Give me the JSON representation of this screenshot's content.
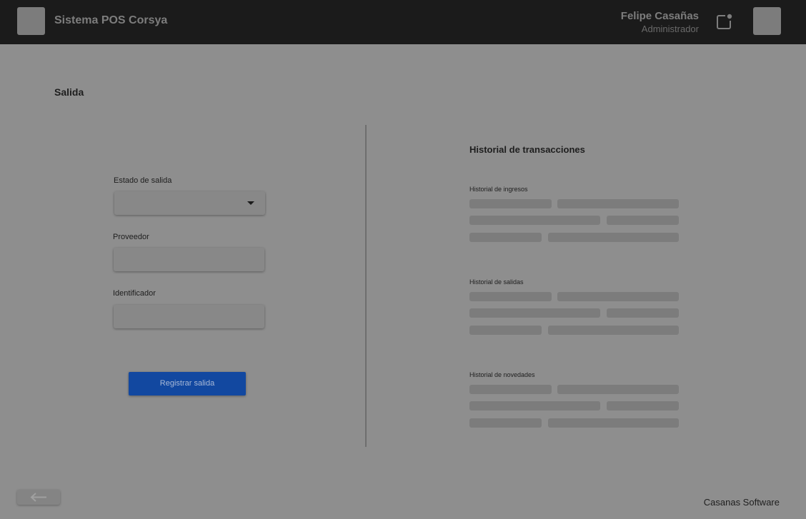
{
  "header": {
    "app_title": "Sistema POS Corsya",
    "user_name": "Felipe Casañas",
    "user_role": "Administrador",
    "logo_icon": "app-logo-placeholder",
    "notification_icon": "notification-icon",
    "avatar_icon": "avatar-placeholder"
  },
  "main": {
    "page_title": "Salida",
    "form": {
      "estado_label": "Estado de salida",
      "estado_value": "",
      "proveedor_label": "Proveedor",
      "proveedor_value": "",
      "identificador_label": "Identificador",
      "identificador_value": "",
      "submit_label": "Registrar salida"
    },
    "history": {
      "title": "Historial de transacciones",
      "sections": [
        {
          "label": "Historial de ingresos"
        },
        {
          "label": "Historial de salidas"
        },
        {
          "label": "Historial de novedades"
        }
      ]
    }
  },
  "footer": {
    "back_icon": "arrow-left-icon",
    "brand": "Casanas Software"
  },
  "colors": {
    "topbar": "#1b1b1b",
    "background": "#8e8e8e",
    "primary_button": "#1248a0"
  }
}
